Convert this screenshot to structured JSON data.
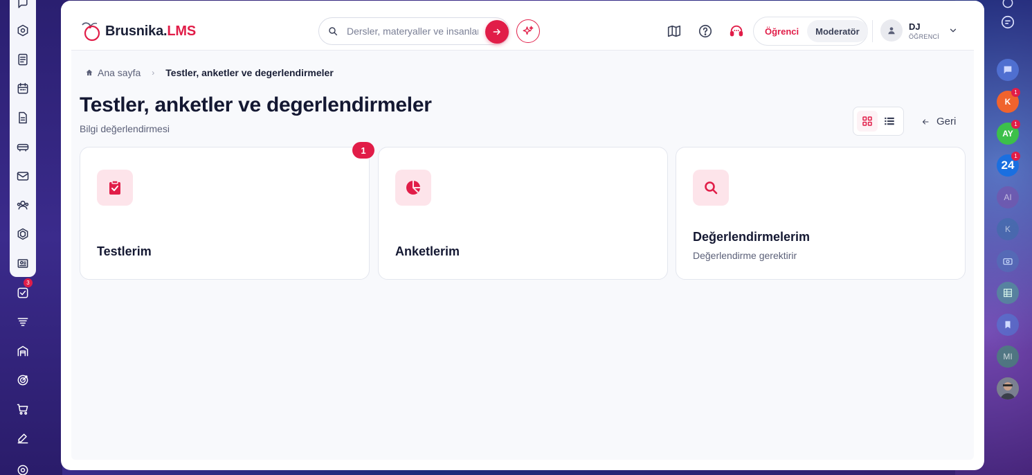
{
  "app": {
    "logo_name": "Brusnika.",
    "logo_accent": "LMS",
    "brand_color": "#e11d48"
  },
  "search": {
    "placeholder": "Dersler, materyaller ve insanlar"
  },
  "header": {
    "roles": [
      {
        "label": "Öğrenci",
        "active": true
      },
      {
        "label": "Moderatör",
        "active": false
      }
    ],
    "user": {
      "initials": "DJ",
      "role": "ÖĞRENCİ"
    }
  },
  "left_sidebar": {
    "items": [
      {
        "icon": "chat-icon"
      },
      {
        "icon": "compass-icon"
      },
      {
        "icon": "news-icon"
      },
      {
        "icon": "calendar-icon"
      },
      {
        "icon": "document-icon"
      },
      {
        "icon": "bus-icon"
      },
      {
        "icon": "mail-icon"
      },
      {
        "icon": "users-icon"
      },
      {
        "icon": "hexagon-icon"
      },
      {
        "icon": "presentation-icon"
      },
      {
        "icon": "tasks-icon",
        "badge": "3"
      },
      {
        "icon": "filter-icon"
      },
      {
        "icon": "warehouse-icon"
      },
      {
        "icon": "target-icon"
      },
      {
        "icon": "cart-icon"
      },
      {
        "icon": "edit-icon"
      },
      {
        "icon": "settings-icon"
      }
    ]
  },
  "right_sidebar": {
    "items": [
      {
        "label": "",
        "icon": "bot-icon",
        "color": "#6f7fb8"
      },
      {
        "label": "",
        "icon": "message-icon",
        "color": "#4f6fd0"
      },
      {
        "label": "K",
        "color": "#f0632d",
        "badge": "1"
      },
      {
        "label": "AY",
        "color": "#3cc04a",
        "badge": "1"
      },
      {
        "label": "24",
        "color": "#1a6fe0",
        "badge": "1"
      },
      {
        "label": "AI",
        "color": "#7e4fa8"
      },
      {
        "label": "K",
        "color": "#3a6fa8"
      },
      {
        "label": "",
        "icon": "camera-icon",
        "color": "#4a7ab8"
      },
      {
        "label": "",
        "icon": "grid-icon",
        "color": "#4aa890"
      },
      {
        "label": "",
        "icon": "bookmark-icon",
        "color": "#4f7fd8"
      },
      {
        "label": "MI",
        "color": "#3e9a6a"
      },
      {
        "label": "",
        "icon": "avatar-photo",
        "color": "#8a6a5a"
      }
    ]
  },
  "breadcrumb": {
    "home": "Ana sayfa",
    "current": "Testler, anketler ve degerlendirmeler"
  },
  "page": {
    "title": "Testler, anketler ve degerlendirmeler",
    "subtitle": "Bilgi değerlendirmesi",
    "back_label": "Geri"
  },
  "cards": [
    {
      "title": "Testlerim",
      "subtitle": "",
      "icon": "clipboard-check-icon",
      "badge": "1"
    },
    {
      "title": "Anketlerim",
      "subtitle": "",
      "icon": "pie-chart-icon",
      "badge": ""
    },
    {
      "title": "Değerlendirmelerim",
      "subtitle": "Değerlendirme gerektirir",
      "icon": "search-icon",
      "badge": ""
    }
  ]
}
